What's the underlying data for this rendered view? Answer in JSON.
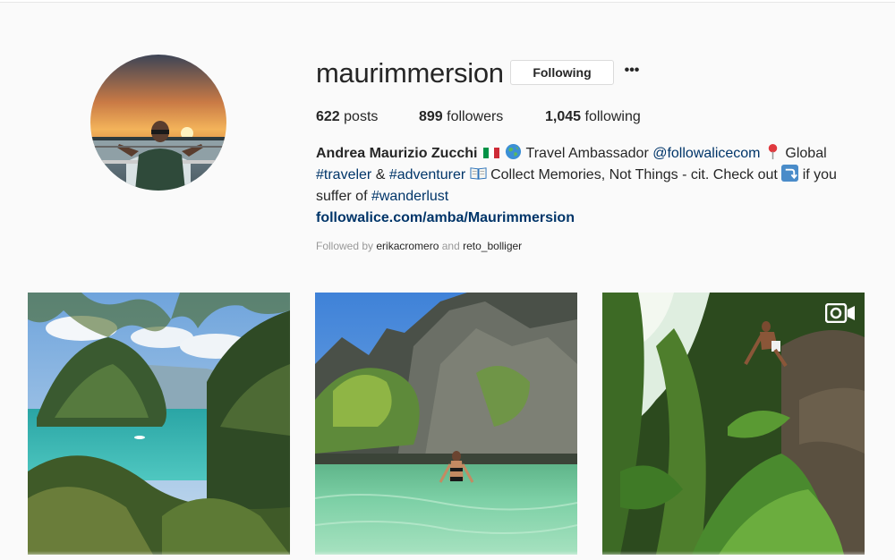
{
  "profile": {
    "username": "maurimmersion",
    "follow_button_label": "Following",
    "more_options": "•••",
    "stats": {
      "posts_count": "622",
      "posts_label": "posts",
      "followers_count": "899",
      "followers_label": "followers",
      "following_count": "1,045",
      "following_label": "following"
    },
    "bio": {
      "full_name": "Andrea Maurizio Zucchi",
      "text_1": " Travel Ambassador ",
      "mention": "@followalicecom",
      "text_2": " Global",
      "hashtag_1": "#traveler",
      "text_3": " & ",
      "hashtag_2": "#adventurer",
      "text_4": " Collect Memories, Not Things - cit. Check out ",
      "text_5": " if you suffer of ",
      "hashtag_3": "#wanderlust",
      "website": "followalice.com/amba/Maurimmersion"
    },
    "followed_by": {
      "prefix": "Followed by",
      "user_1": "erikacromero",
      "conjunction": "and",
      "user_2": "reto_bolliger"
    }
  },
  "posts": [
    {
      "description_icon": "photo-icon",
      "is_video": false
    },
    {
      "description_icon": "photo-icon",
      "is_video": false
    },
    {
      "description_icon": "video-icon",
      "is_video": true
    }
  ],
  "colors": {
    "background": "#fafafa",
    "text": "#262626",
    "link": "#003569",
    "muted": "#999999",
    "border": "#dbdbdb"
  }
}
